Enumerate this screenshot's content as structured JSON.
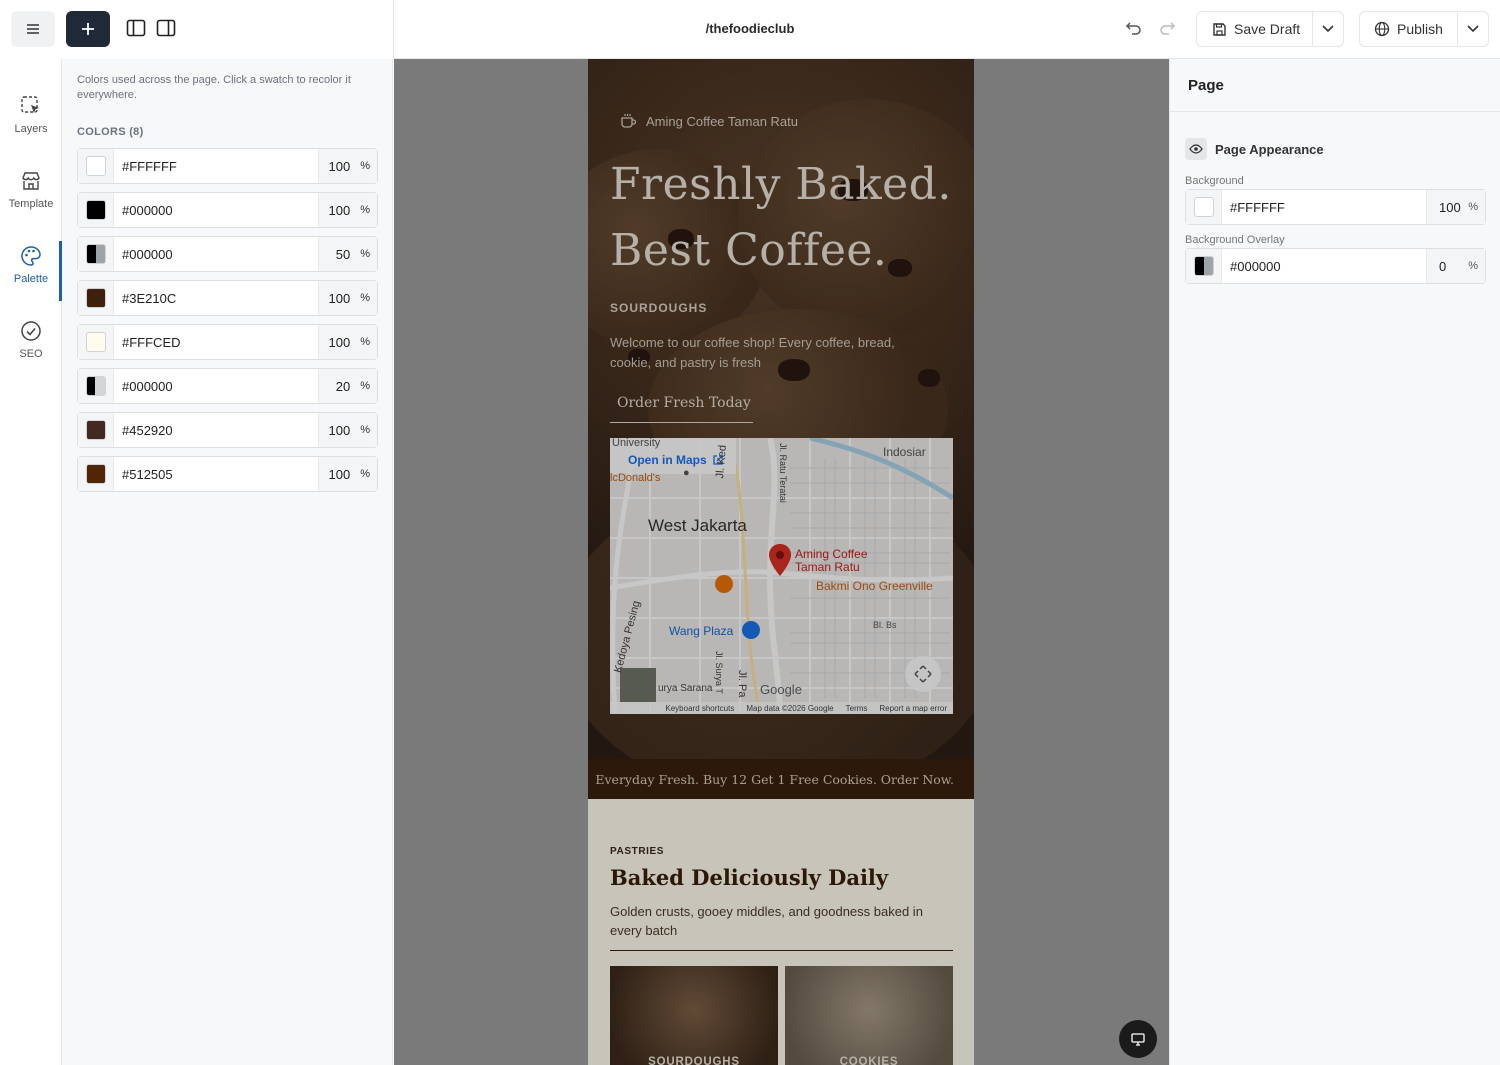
{
  "topbar": {
    "page_path": "/thefoodieclub",
    "save_draft_label": "Save Draft",
    "publish_label": "Publish"
  },
  "rail": {
    "items": [
      {
        "label": "Layers",
        "icon": "layers-icon"
      },
      {
        "label": "Template",
        "icon": "storefront-icon"
      },
      {
        "label": "Palette",
        "icon": "palette-icon",
        "active": true
      },
      {
        "label": "SEO",
        "icon": "check-circle-icon"
      }
    ]
  },
  "palette": {
    "hint": "Colors used across the page. Click a swatch to recolor it everywhere.",
    "section_label": "COLORS (8)",
    "percent_sign": "%",
    "colors": [
      {
        "hex": "#FFFFFF",
        "opacity": "100",
        "swatch": "#FFFFFF"
      },
      {
        "hex": "#000000",
        "opacity": "100",
        "swatch": "#000000"
      },
      {
        "hex": "#000000",
        "opacity": "50",
        "swatch": "#000000"
      },
      {
        "hex": "#3E210C",
        "opacity": "100",
        "swatch": "#3E210C"
      },
      {
        "hex": "#FFFCED",
        "opacity": "100",
        "swatch": "#FFFCED"
      },
      {
        "hex": "#000000",
        "opacity": "20",
        "swatch": "#000000"
      },
      {
        "hex": "#452920",
        "opacity": "100",
        "swatch": "#452920"
      },
      {
        "hex": "#512505",
        "opacity": "100",
        "swatch": "#512505"
      }
    ]
  },
  "site": {
    "brand": "Aming Coffee Taman Ratu",
    "headline_1": "Freshly Baked.",
    "headline_2": "Best Coffee.",
    "kicker": "SOURDOUGHS",
    "intro": "Welcome to our coffee shop! Every coffee, bread, cookie, and pastry is fresh",
    "cta": "Order Fresh Today",
    "map": {
      "open_in_maps": "Open in Maps",
      "labels": {
        "university": "University",
        "mcdonalds": "lcDonald's",
        "jl_ked": "Jl. Ked",
        "jl_ratu_teratai": "Jl. Ratu Teratai",
        "indosiar": "Indosiar",
        "west_jakarta": "West Jakarta",
        "aming_1": "Aming Coffee",
        "aming_2": "Taman Ratu",
        "bakmi": "Bakmi Ono Greenville",
        "wang_plaza": "Wang Plaza",
        "bl_bs": "Bl. Bs",
        "kedoya": "Kedoya Pesing",
        "surya": "urya Sarana",
        "jl_surya": "Jl. Surya T",
        "jl_pa": "Jl. Pa",
        "google": "Google"
      },
      "footer": [
        "Keyboard shortcuts",
        "Map data ©2026 Google",
        "Terms",
        "Report a map error"
      ]
    },
    "banner": "Everyday Fresh. Buy 12 Get 1 Free Cookies. Order Now.",
    "section_kicker": "PASTRIES",
    "section_title": "Baked Deliciously Daily",
    "section_text": "Golden crusts, gooey middles, and goodness baked in every batch",
    "cards": [
      "SOURDOUGHS",
      "COOKIES"
    ]
  },
  "right_panel": {
    "title": "Page",
    "section": "Page Appearance",
    "background_label": "Background",
    "background_hex": "#FFFFFF",
    "background_opacity": "100",
    "overlay_label": "Background Overlay",
    "overlay_hex": "#000000",
    "overlay_opacity": "0",
    "percent_sign": "%"
  },
  "colors": {
    "accent": "#1e5fa8",
    "dark_button": "#1f2937",
    "brand_brown": "#3E210C",
    "cream": "#FFFCED"
  }
}
